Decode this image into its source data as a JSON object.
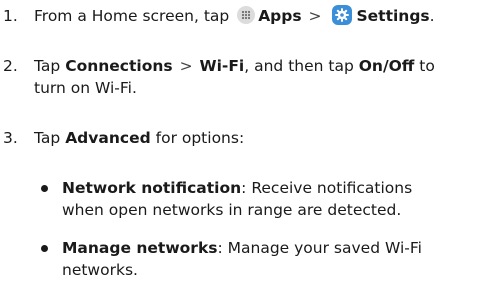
{
  "steps": [
    {
      "number": "1.",
      "prefix": "From a Home screen, tap",
      "apps_icon": "apps-grid-icon",
      "apps": "Apps",
      "separator": ">",
      "settings_icon": "settings-gear-icon",
      "settings": "Settings",
      "suffix": "."
    },
    {
      "number": "2.",
      "prefix": "Tap",
      "connections": "Connections",
      "separator": ">",
      "wifi": "Wi-Fi",
      "middle": ", and then tap",
      "onoff": "On/Off",
      "suffix_line1": "to",
      "suffix_line2": "turn on Wi-Fi."
    },
    {
      "number": "3.",
      "prefix": "Tap",
      "advanced": "Advanced",
      "suffix": "for options:"
    }
  ],
  "bullets": [
    {
      "term": "Network notification",
      "line1": ": Receive notifications",
      "line2": "when open networks in range are detected."
    },
    {
      "term": "Manage networks",
      "line1": ": Manage your saved Wi-Fi",
      "line2": "networks."
    }
  ],
  "colors": {
    "text": "#1a1a1a",
    "apps_icon_bg": "#dcdcdc",
    "settings_icon_bg": "#3b8fd8"
  }
}
